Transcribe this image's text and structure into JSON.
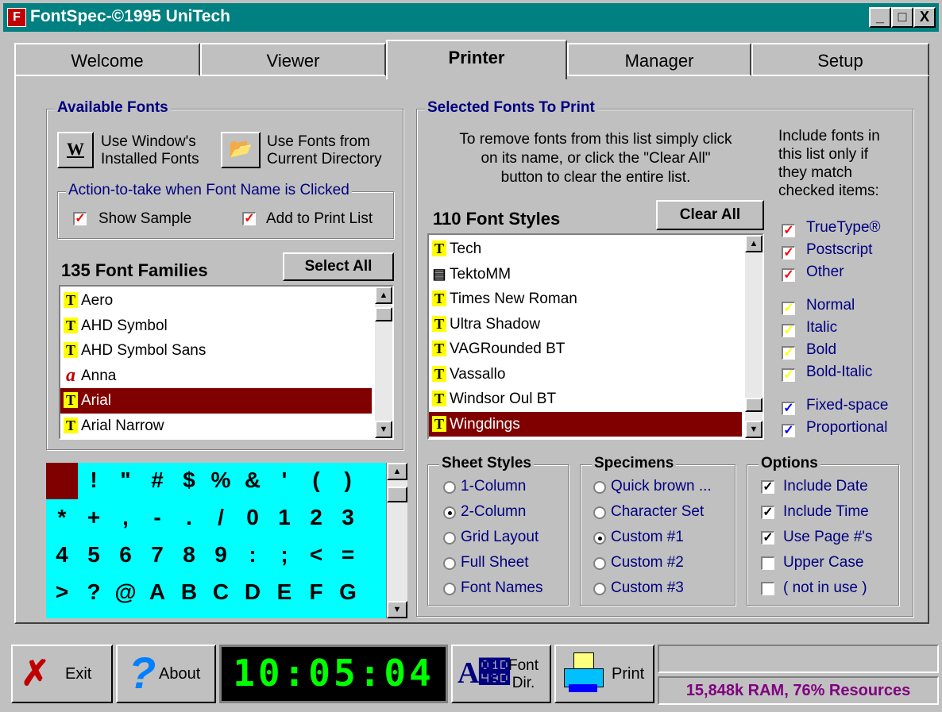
{
  "window": {
    "title": "FontSpec-©1995 UniTech",
    "controls": [
      "_",
      "□",
      "X"
    ]
  },
  "tabs": [
    "Welcome",
    "Viewer",
    "Printer",
    "Manager",
    "Setup"
  ],
  "available": {
    "title": "Available Fonts",
    "btn_installed": [
      "Use Window's",
      "Installed Fonts"
    ],
    "btn_current": [
      "Use Fonts from",
      "Current Directory"
    ],
    "action_title": "Action-to-take when Font Name is Clicked",
    "show_sample": "Show Sample",
    "add_to_print": "Add to Print List",
    "count_label": "135 Font Families",
    "select_all": "Select All",
    "fonts": [
      "Aero",
      "AHD Symbol",
      "AHD Symbol Sans",
      "Anna",
      "Arial",
      "Arial Narrow"
    ],
    "selected_font": "Arial"
  },
  "selected": {
    "title": "Selected Fonts To Print",
    "instructions": [
      "To remove fonts from this list simply click",
      "on its name, or click the \"Clear All\"",
      "button to clear the entire list."
    ],
    "count_label": "110 Font Styles",
    "clear_all": "Clear All",
    "fonts": [
      "Tech",
      "TektoMM",
      "Times New Roman",
      "Ultra Shadow",
      "VAGRounded BT",
      "Vassallo",
      "Windsor Oul BT",
      "Wingdings"
    ],
    "selected_font": "Wingdings",
    "include_note": [
      "Include fonts in",
      "this list only if",
      "they match",
      "checked items:"
    ],
    "filters_type": [
      "TrueType®",
      "Postscript",
      "Other"
    ],
    "filters_style": [
      "Normal",
      "Italic",
      "Bold",
      "Bold-Italic"
    ],
    "filters_space": [
      "Fixed-space",
      "Proportional"
    ],
    "colors": {
      "type": "#ff0000",
      "style": "#ffff00",
      "space": "#0000ff"
    }
  },
  "sheet_styles": {
    "title": "Sheet Styles",
    "options": [
      "1-Column",
      "2-Column",
      "Grid Layout",
      "Full Sheet",
      "Font Names"
    ],
    "selected": "2-Column"
  },
  "specimens": {
    "title": "Specimens",
    "options": [
      "Quick brown ...",
      "Character Set",
      "Custom #1",
      "Custom #2",
      "Custom #3"
    ],
    "selected": "Custom #1"
  },
  "options": {
    "title": "Options",
    "items": [
      "Include Date",
      "Include Time",
      "Use Page #'s",
      "Upper Case",
      "( not in use )"
    ],
    "checked": [
      true,
      true,
      true,
      false,
      false
    ]
  },
  "charset": [
    [
      "",
      "!",
      "\"",
      "#",
      "$",
      "%",
      "&",
      "'",
      "(",
      ")"
    ],
    [
      "*",
      "+",
      ",",
      "-",
      ".",
      "/",
      "0",
      "1",
      "2",
      "3"
    ],
    [
      "4",
      "5",
      "6",
      "7",
      "8",
      "9",
      ":",
      ";",
      "<",
      "="
    ],
    [
      ">",
      "?",
      "@",
      "A",
      "B",
      "C",
      "D",
      "E",
      "F",
      "G"
    ]
  ],
  "bottom": {
    "exit": "Exit",
    "about": "About",
    "clock": "10:05:04",
    "font_dir": [
      "Font",
      "Dir."
    ],
    "print": "Print",
    "status": "15,848k RAM, 76% Resources"
  }
}
